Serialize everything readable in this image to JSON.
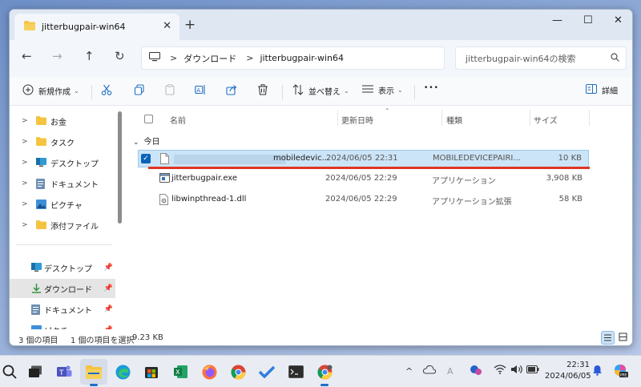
{
  "window": {
    "tab_title": "jitterbugpair-win64",
    "new_tab": "+",
    "minimize": "—",
    "maximize": "☐",
    "close": "✕",
    "tab_close": "✕"
  },
  "address": {
    "back": "←",
    "forward": "→",
    "up": "↑",
    "refresh": "↻",
    "breadcrumb_sep": ">",
    "breadcrumbs": [
      "ダウンロード",
      "jitterbugpair-win64"
    ],
    "search_placeholder": "jitterbugpair-win64の検索"
  },
  "toolbar": {
    "new_label": "新規作成",
    "sort_label": "並べ替え",
    "view_label": "表示",
    "more_label": "•••",
    "details_label": "詳細"
  },
  "sidebar": {
    "tree": [
      {
        "label": "お金",
        "icon": "folder-icon"
      },
      {
        "label": "タスク",
        "icon": "folder-icon"
      },
      {
        "label": "デスクトップ",
        "icon": "desktop-icon"
      },
      {
        "label": "ドキュメント",
        "icon": "document-icon"
      },
      {
        "label": "ピクチャ",
        "icon": "picture-icon"
      },
      {
        "label": "添付ファイル",
        "icon": "folder-icon"
      }
    ],
    "quick_access": [
      {
        "label": "デスクトップ",
        "icon": "desktop-icon"
      },
      {
        "label": "ダウンロード",
        "icon": "download-icon",
        "selected": true
      },
      {
        "label": "ドキュメント",
        "icon": "document-icon"
      },
      {
        "label": "ピクチャ",
        "icon": "picture-icon"
      }
    ]
  },
  "columns": {
    "name": "名前",
    "modified": "更新日時",
    "type": "種類",
    "size": "サイズ"
  },
  "group_label": "今日",
  "files": [
    {
      "name": "mobiledevic...",
      "modified": "2024/06/05 22:31",
      "type": "MOBILEDEVICEPAIRI...",
      "size": "10 KB",
      "selected": true
    },
    {
      "name": "jitterbugpair.exe",
      "modified": "2024/06/05 22:29",
      "type": "アプリケーション",
      "size": "3,908 KB"
    },
    {
      "name": "libwinpthread-1.dll",
      "modified": "2024/06/05 22:29",
      "type": "アプリケーション拡張",
      "size": "58 KB"
    }
  ],
  "status": {
    "item_count": "3 個の項目",
    "selection": "1 個の項目を選択",
    "selection_size": "9.23 KB"
  },
  "taskbar": {
    "time": "22:31",
    "date": "2024/06/05",
    "ime": "A"
  },
  "colors": {
    "accent": "#0a63b8",
    "selection_bg": "#cce4f7",
    "annotation_red": "#e03524",
    "folder_yellow": "#f4c441"
  }
}
